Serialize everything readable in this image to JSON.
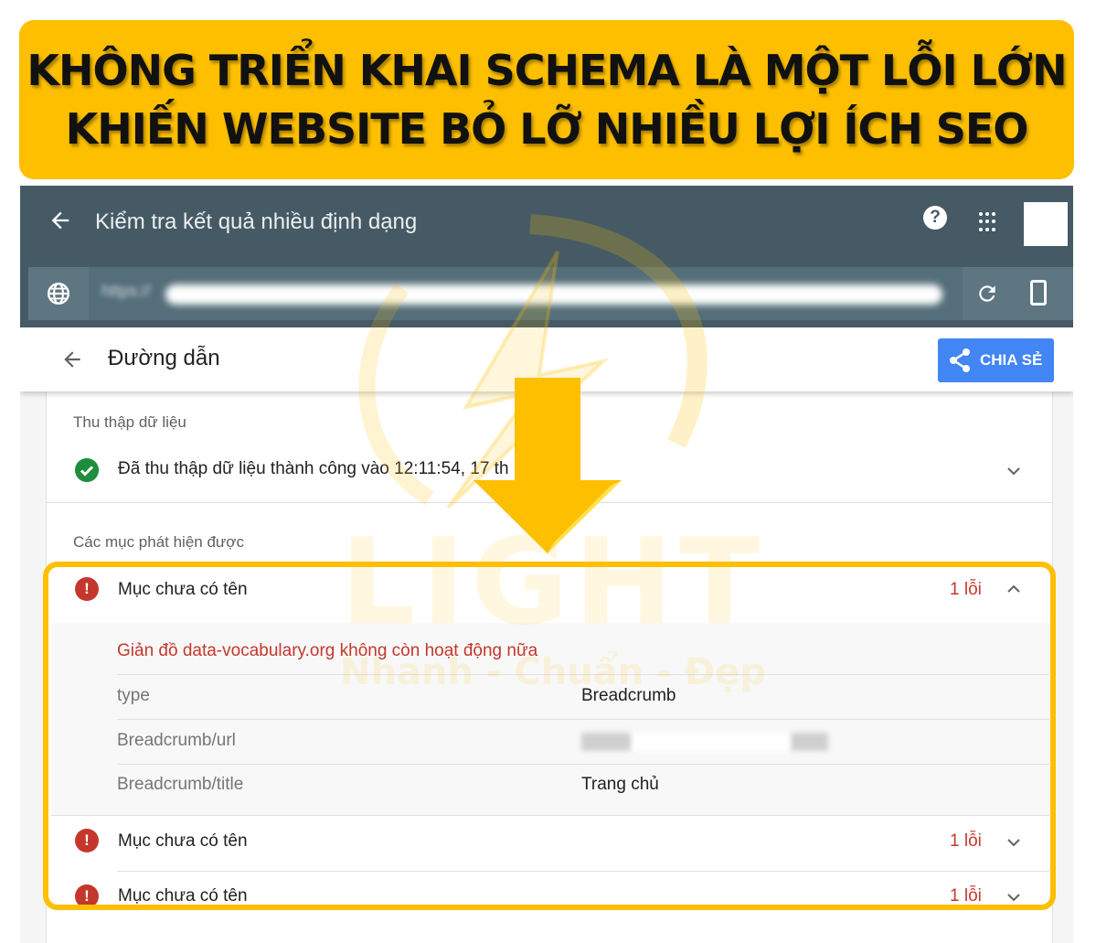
{
  "banner": {
    "line1": "KHÔNG TRIỂN KHAI SCHEMA LÀ MỘT LỖI LỚN",
    "line2": "KHIẾN WEBSITE BỎ LỠ NHIỀU LỢI ÍCH SEO",
    "color": "#fdbf00"
  },
  "appbar": {
    "back_icon": "arrow-left-icon",
    "title": "Kiểm tra kết quả nhiều định dạng",
    "help_icon": "help-circle-icon",
    "help_glyph": "?",
    "apps_icon": "apps-grid-icon",
    "color": "#455a64"
  },
  "urlbar": {
    "globe_icon": "globe-icon",
    "url_prefix": "https://",
    "reload_icon": "reload-icon",
    "device_icon": "smartphone-icon"
  },
  "subheader": {
    "back_icon": "arrow-left-icon",
    "title": "Đường dẫn",
    "share_label": "CHIA SẺ",
    "share_icon": "share-icon",
    "share_color": "#4285f4"
  },
  "crawl": {
    "section_label": "Thu thập dữ liệu",
    "status_text": "Đã thu thập dữ liệu thành công vào 12:11:54, 17 th",
    "status_icon": "check-circle-icon"
  },
  "detected": {
    "section_label": "Các mục phát hiện được",
    "items": [
      {
        "title": "Mục chưa có tên",
        "error_count": "1 lỗi",
        "expanded": true,
        "error_message": "Giản đồ data-vocabulary.org không còn hoạt động nữa",
        "properties": [
          {
            "key": "type",
            "value": "Breadcrumb"
          },
          {
            "key": "Breadcrumb/url",
            "value": "https://"
          },
          {
            "key": "Breadcrumb/title",
            "value": "Trang chủ"
          }
        ]
      },
      {
        "title": "Mục chưa có tên",
        "error_count": "1 lỗi",
        "expanded": false
      },
      {
        "title": "Mục chưa có tên",
        "error_count": "1 lỗi",
        "expanded": false
      }
    ],
    "error_color": "#c5372c"
  },
  "watermark": {
    "brand": "LIGHT",
    "slogan": "Nhanh - Chuẩn - Đẹp"
  }
}
